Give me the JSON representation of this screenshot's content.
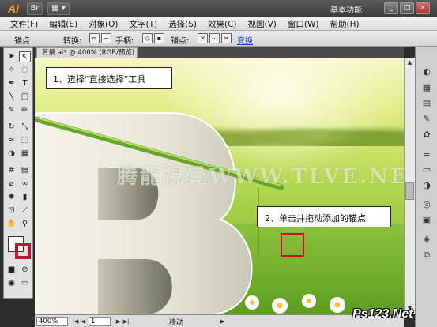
{
  "app": {
    "logo": "Ai",
    "workspace": "基本功能",
    "title_buttons": [
      "Br",
      "▦ ▾"
    ],
    "window_buttons": [
      "_",
      "□",
      "×"
    ]
  },
  "menu": [
    "文件(F)",
    "编辑(E)",
    "对象(O)",
    "文字(T)",
    "选择(S)",
    "效果(C)",
    "视图(V)",
    "窗口(W)",
    "帮助(H)"
  ],
  "control_bar": {
    "tool_label": "锚点",
    "convert_label": "转换:",
    "handles_label": "手柄:",
    "anchors_label": "锚点:",
    "link_label": "变换"
  },
  "document": {
    "tab_label": "背景.ai* @ 400% (RGB/预览)"
  },
  "canvas": {
    "callout_1": "1、选择“直接选择”工具",
    "callout_2": "2、单击并拖动添加的锚点",
    "watermark": "腾龍視覺WWW.TLVE.NET"
  },
  "status_bar": {
    "zoom": "400%",
    "page": "1",
    "status": "移动"
  },
  "site_logo": "Ps123.Net",
  "colors": {
    "callout_marker": "#c8102e",
    "stroke_green": "#6aa22a",
    "logo_orange": "#f7a12a"
  }
}
